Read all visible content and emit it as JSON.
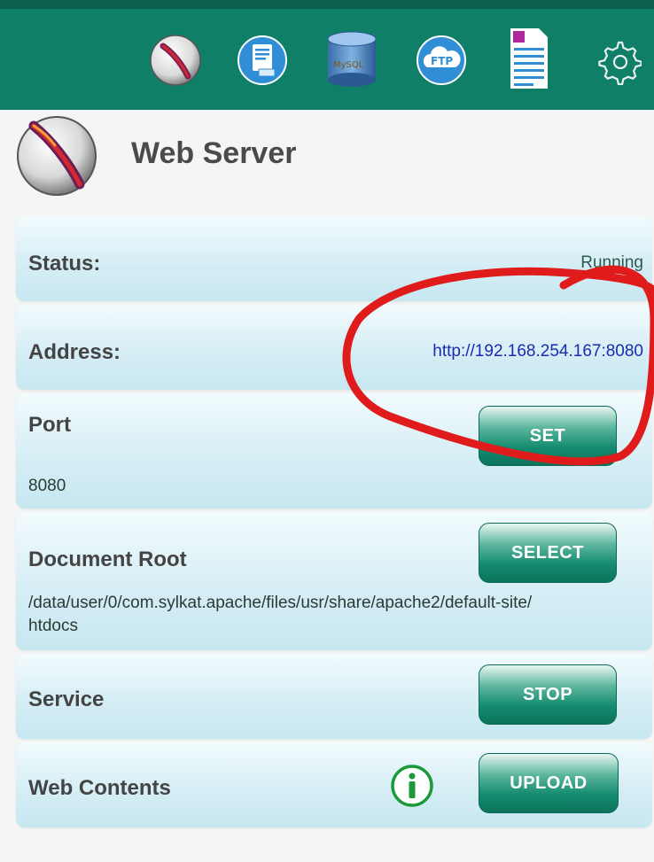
{
  "toolbar": {
    "icons": [
      "apache-feather-icon",
      "document-icon",
      "mysql-database-icon",
      "ftp-cloud-icon",
      "text-file-icon",
      "gear-icon"
    ],
    "db_icon_label": "MySQL",
    "ftp_label": "FTP"
  },
  "header": {
    "title": "Web Server"
  },
  "status": {
    "label": "Status:",
    "value": "Running"
  },
  "address": {
    "label": "Address:",
    "value": "http://192.168.254.167:8080"
  },
  "port": {
    "label": "Port",
    "value": "8080",
    "button": "SET"
  },
  "docroot": {
    "label": "Document Root",
    "value_line1": "/data/user/0/com.sylkat.apache/files/usr/share/apache2/default-site/",
    "value_line2": "htdocs",
    "button": "SELECT"
  },
  "service": {
    "label": "Service",
    "button": "STOP"
  },
  "webcontents": {
    "label": "Web Contents",
    "button": "UPLOAD"
  },
  "colors": {
    "toolbar": "#0f7f67",
    "accent": "#138b6f",
    "link": "#1a2bb0",
    "annotation": "#e01b1b"
  }
}
